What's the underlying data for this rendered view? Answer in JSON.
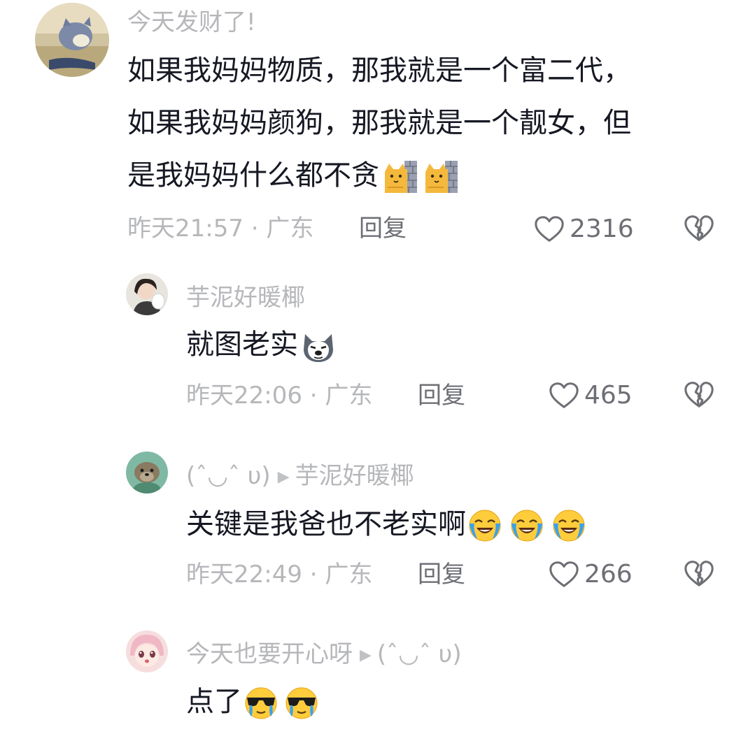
{
  "comments": [
    {
      "username": "今天发财了!",
      "text": [
        "如果我妈妈物质，那我就是一个富二代，",
        "如果我妈妈颜狗，那我就是一个靓女，但",
        "是我妈妈什么都不贪"
      ],
      "time_location": "昨天21:57 · 广东",
      "reply_label": "回复",
      "likes": "2316",
      "emojis": [
        "wall-cat-emoji",
        "wall-cat-emoji"
      ]
    },
    {
      "username": "芋泥好暖椰",
      "text": "就图老实",
      "time_location": "昨天22:06 · 广东",
      "reply_label": "回复",
      "likes": "465",
      "emojis": [
        "husky-emoji"
      ]
    },
    {
      "username": "(ˆ◡ˆ υ)",
      "reply_to": "芋泥好暖椰",
      "text": "关键是我爸也不老实啊",
      "time_location": "昨天22:49 · 广东",
      "reply_label": "回复",
      "likes": "266",
      "emojis": [
        "cry-laugh-emoji",
        "cry-laugh-emoji",
        "cry-laugh-emoji"
      ]
    },
    {
      "username": "今天也要开心呀",
      "reply_to": "(ˆ◡ˆ υ)",
      "text": "点了",
      "emojis": [
        "cool-tears-emoji",
        "cool-tears-emoji"
      ]
    }
  ],
  "icons": {
    "like": "heart-outline-icon",
    "dislike": "broken-heart-icon",
    "reply_arrow": "triangle-right-icon"
  },
  "colors": {
    "text": "#161823",
    "secondary": "#b6b7ba",
    "action": "#6e6f75"
  }
}
